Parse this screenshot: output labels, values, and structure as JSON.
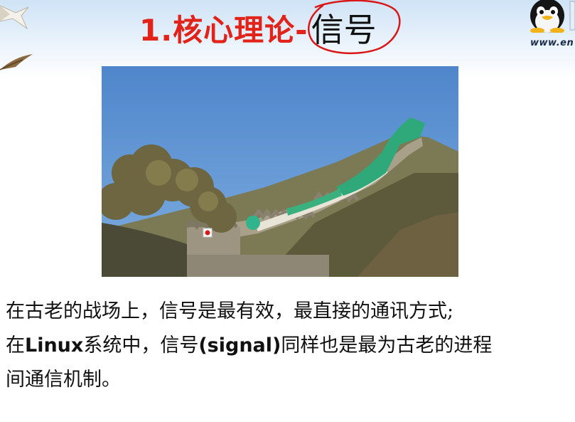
{
  "slide": {
    "title_main": "1.核心理论-",
    "title_highlight": "信号",
    "website": "www.en",
    "paragraph": {
      "line1": "在古老的战场上，信号是最有效，最直接的通讯方式;",
      "line2_a": "在",
      "line2_b": "Linux",
      "line2_c": "系统中，信号",
      "line2_d": "(signal)",
      "line2_e": "同样也是最为古老的进程",
      "line3": "间通信机制。"
    }
  },
  "icons": {
    "mascot": "penguin-icon",
    "decoration_top": "bird-icon",
    "decoration_mid": "bird-icon",
    "highlight": "hand-drawn-circle",
    "cursor": "cursor-icon"
  },
  "colors": {
    "title_red": "#e2231a",
    "circle_red": "#d81818",
    "text": "#111111",
    "sky": "#5b8fd0"
  }
}
